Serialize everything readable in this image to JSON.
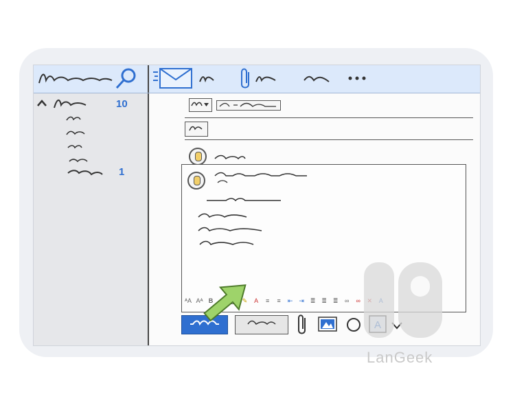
{
  "navigation": {
    "folder_count_top": "10",
    "folder_count_bottom": "1"
  },
  "watermark": "LanGeek",
  "colors": {
    "accent": "#2f6fd0",
    "toolbar_bg": "#dce9fb",
    "sidebar_bg": "#e6e7ea",
    "arrow": "#9ed36a"
  },
  "icons": {
    "search": "search-icon",
    "mail": "envelope-icon",
    "attach": "paperclip-icon",
    "more": "more-icon"
  }
}
